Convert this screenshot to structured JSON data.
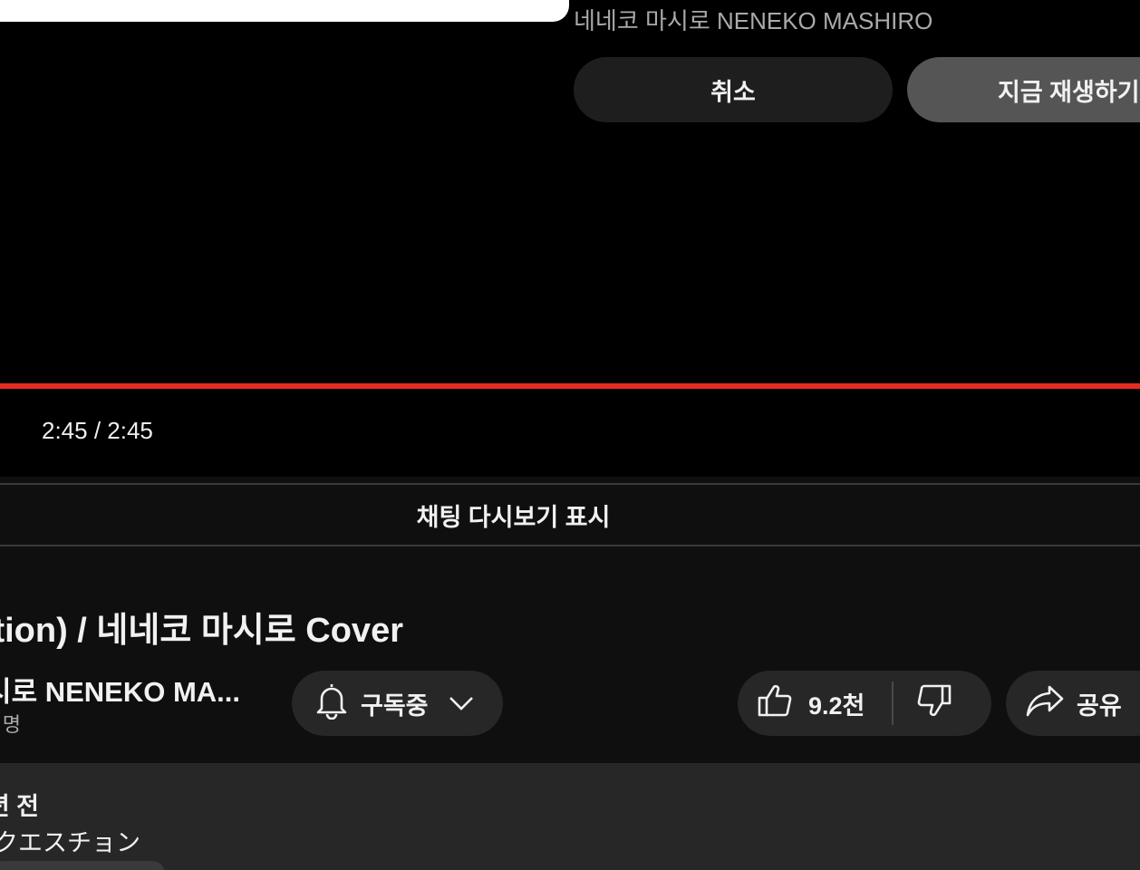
{
  "player": {
    "next_video_channel": "네네코 마시로 NENEKO MASHIRO",
    "cancel_label": "취소",
    "play_now_label": "지금 재생하기",
    "progress_fraction": 1.0,
    "time_display": "2:45 / 2:45"
  },
  "chat_replay_label": "채팅 다시보기 표시",
  "video": {
    "title_visible": "tion) / 네네코 마시로 Cover",
    "channel_name": "시로 NENEKO MA...",
    "subscriber_count": "명",
    "subscribe_label": "구독중",
    "like_count": "9.2천",
    "share_label": "공유"
  },
  "description": {
    "line1": "년 전",
    "line2": "】クエスチョン"
  },
  "colors": {
    "progress": "#e62c1e",
    "background": "#0f0f0f",
    "pill": "#272727"
  }
}
